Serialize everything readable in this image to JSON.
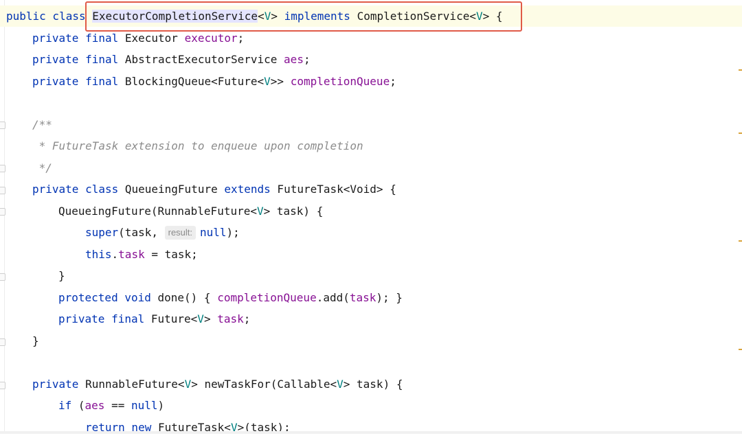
{
  "code": {
    "l1": {
      "public_class": "public class ",
      "class_name": "ExecutorCompletionService",
      "lt": "<",
      "type_param": "V",
      "gt_sp": "> ",
      "implements": "implements",
      "iface": " CompletionService<",
      "iface_param": "V",
      "tail": "> {"
    },
    "l2": {
      "mod": "private final ",
      "type": "Executor ",
      "field": "executor",
      "semi": ";"
    },
    "l3": {
      "mod": "private final ",
      "type": "AbstractExecutorService ",
      "field": "aes",
      "semi": ";"
    },
    "l4": {
      "mod": "private final ",
      "type_a": "BlockingQueue<Future<",
      "type_param": "V",
      "type_b": ">> ",
      "field": "completionQueue",
      "semi": ";"
    },
    "l6": {
      "comment": "/**"
    },
    "l7": {
      "comment": " * FutureTask extension to enqueue upon completion"
    },
    "l8": {
      "comment": " */"
    },
    "l9": {
      "mod": "private class ",
      "name": "QueueingFuture ",
      "extends": "extends",
      "rest": " FutureTask<Void> {"
    },
    "l10": {
      "name": "QueueingFuture(RunnableFuture<",
      "type_param": "V",
      "rest": "> task) {"
    },
    "l11": {
      "super": "super",
      "args": "(task, ",
      "hint": "result:",
      "null": "null",
      "end": ");"
    },
    "l12": {
      "this": "this",
      "dot": ".",
      "field": "task",
      "rest": " = task;"
    },
    "l13": {
      "text": "}"
    },
    "l14": {
      "mod": "protected void ",
      "name": "done() { ",
      "field": "completionQueue",
      "call": ".add(",
      "field2": "task",
      "end": "); }"
    },
    "l15": {
      "mod": "private final ",
      "type": "Future<",
      "type_param": "V",
      "gt": "> ",
      "field": "task",
      "semi": ";"
    },
    "l16": {
      "text": "}"
    },
    "l18": {
      "mod": "private ",
      "type": "RunnableFuture<",
      "type_param": "V",
      "mid": "> newTaskFor(Callable<",
      "type_param2": "V",
      "rest": "> task) {"
    },
    "l19": {
      "kw": "if",
      "open": " (",
      "field": "aes",
      "op": " == ",
      "null": "null",
      "close": ")"
    },
    "l20": {
      "kw": "return new ",
      "type": "FutureTask<",
      "type_param": "V",
      "rest": ">(task);"
    }
  },
  "colors": {
    "keyword": "#0033b3",
    "type_param": "#008080",
    "field": "#871094",
    "comment": "#8c8c8c",
    "highlight_box": "#e05a47"
  }
}
